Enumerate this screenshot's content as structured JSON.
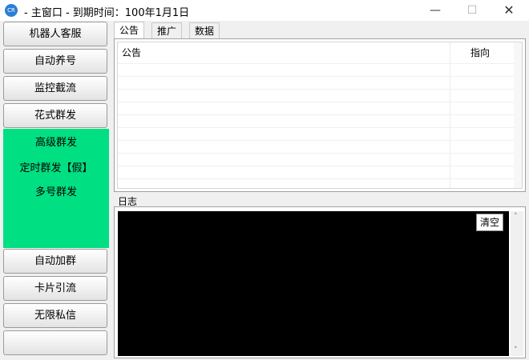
{
  "window": {
    "title": "- 主窗口 -  到期时间：100年1月1日",
    "app_icon": "app-logo-icon",
    "minimize": "—",
    "maximize": "☐",
    "close": "✕"
  },
  "sidebar": {
    "buttons": [
      {
        "label": "机器人客服"
      },
      {
        "label": "自动养号"
      },
      {
        "label": "监控截流"
      },
      {
        "label": "花式群发"
      },
      {
        "label": "自动加群"
      },
      {
        "label": "卡片引流"
      },
      {
        "label": "无限私信"
      },
      {
        "label": ""
      }
    ],
    "green_panel": {
      "color": "#00df82",
      "items": [
        {
          "label": "高级群发"
        },
        {
          "label": "定时群发【假】"
        },
        {
          "label": "多号群发"
        }
      ]
    }
  },
  "tabs": [
    {
      "label": "公告",
      "active": true
    },
    {
      "label": "推广",
      "active": false
    },
    {
      "label": "数据",
      "active": false
    }
  ],
  "announcement_table": {
    "columns": [
      "公告",
      "指向"
    ]
  },
  "log": {
    "label": "日志",
    "clear_label": "清空",
    "background": "#000000",
    "scroll_up": "˄",
    "scroll_down": "˅"
  }
}
